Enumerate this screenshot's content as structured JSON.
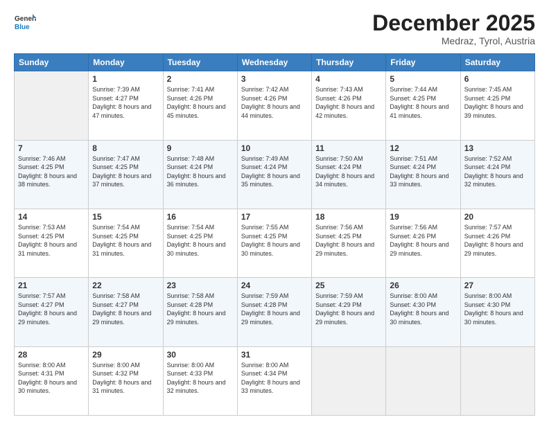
{
  "logo": {
    "line1": "General",
    "line2": "Blue"
  },
  "title": "December 2025",
  "location": "Medraz, Tyrol, Austria",
  "weekdays": [
    "Sunday",
    "Monday",
    "Tuesday",
    "Wednesday",
    "Thursday",
    "Friday",
    "Saturday"
  ],
  "weeks": [
    [
      {
        "day": null
      },
      {
        "day": "1",
        "sunrise": "7:39 AM",
        "sunset": "4:27 PM",
        "daylight": "8 hours and 47 minutes."
      },
      {
        "day": "2",
        "sunrise": "7:41 AM",
        "sunset": "4:26 PM",
        "daylight": "8 hours and 45 minutes."
      },
      {
        "day": "3",
        "sunrise": "7:42 AM",
        "sunset": "4:26 PM",
        "daylight": "8 hours and 44 minutes."
      },
      {
        "day": "4",
        "sunrise": "7:43 AM",
        "sunset": "4:26 PM",
        "daylight": "8 hours and 42 minutes."
      },
      {
        "day": "5",
        "sunrise": "7:44 AM",
        "sunset": "4:25 PM",
        "daylight": "8 hours and 41 minutes."
      },
      {
        "day": "6",
        "sunrise": "7:45 AM",
        "sunset": "4:25 PM",
        "daylight": "8 hours and 39 minutes."
      }
    ],
    [
      {
        "day": "7",
        "sunrise": "7:46 AM",
        "sunset": "4:25 PM",
        "daylight": "8 hours and 38 minutes."
      },
      {
        "day": "8",
        "sunrise": "7:47 AM",
        "sunset": "4:25 PM",
        "daylight": "8 hours and 37 minutes."
      },
      {
        "day": "9",
        "sunrise": "7:48 AM",
        "sunset": "4:24 PM",
        "daylight": "8 hours and 36 minutes."
      },
      {
        "day": "10",
        "sunrise": "7:49 AM",
        "sunset": "4:24 PM",
        "daylight": "8 hours and 35 minutes."
      },
      {
        "day": "11",
        "sunrise": "7:50 AM",
        "sunset": "4:24 PM",
        "daylight": "8 hours and 34 minutes."
      },
      {
        "day": "12",
        "sunrise": "7:51 AM",
        "sunset": "4:24 PM",
        "daylight": "8 hours and 33 minutes."
      },
      {
        "day": "13",
        "sunrise": "7:52 AM",
        "sunset": "4:24 PM",
        "daylight": "8 hours and 32 minutes."
      }
    ],
    [
      {
        "day": "14",
        "sunrise": "7:53 AM",
        "sunset": "4:25 PM",
        "daylight": "8 hours and 31 minutes."
      },
      {
        "day": "15",
        "sunrise": "7:54 AM",
        "sunset": "4:25 PM",
        "daylight": "8 hours and 31 minutes."
      },
      {
        "day": "16",
        "sunrise": "7:54 AM",
        "sunset": "4:25 PM",
        "daylight": "8 hours and 30 minutes."
      },
      {
        "day": "17",
        "sunrise": "7:55 AM",
        "sunset": "4:25 PM",
        "daylight": "8 hours and 30 minutes."
      },
      {
        "day": "18",
        "sunrise": "7:56 AM",
        "sunset": "4:25 PM",
        "daylight": "8 hours and 29 minutes."
      },
      {
        "day": "19",
        "sunrise": "7:56 AM",
        "sunset": "4:26 PM",
        "daylight": "8 hours and 29 minutes."
      },
      {
        "day": "20",
        "sunrise": "7:57 AM",
        "sunset": "4:26 PM",
        "daylight": "8 hours and 29 minutes."
      }
    ],
    [
      {
        "day": "21",
        "sunrise": "7:57 AM",
        "sunset": "4:27 PM",
        "daylight": "8 hours and 29 minutes."
      },
      {
        "day": "22",
        "sunrise": "7:58 AM",
        "sunset": "4:27 PM",
        "daylight": "8 hours and 29 minutes."
      },
      {
        "day": "23",
        "sunrise": "7:58 AM",
        "sunset": "4:28 PM",
        "daylight": "8 hours and 29 minutes."
      },
      {
        "day": "24",
        "sunrise": "7:59 AM",
        "sunset": "4:28 PM",
        "daylight": "8 hours and 29 minutes."
      },
      {
        "day": "25",
        "sunrise": "7:59 AM",
        "sunset": "4:29 PM",
        "daylight": "8 hours and 29 minutes."
      },
      {
        "day": "26",
        "sunrise": "8:00 AM",
        "sunset": "4:30 PM",
        "daylight": "8 hours and 30 minutes."
      },
      {
        "day": "27",
        "sunrise": "8:00 AM",
        "sunset": "4:30 PM",
        "daylight": "8 hours and 30 minutes."
      }
    ],
    [
      {
        "day": "28",
        "sunrise": "8:00 AM",
        "sunset": "4:31 PM",
        "daylight": "8 hours and 30 minutes."
      },
      {
        "day": "29",
        "sunrise": "8:00 AM",
        "sunset": "4:32 PM",
        "daylight": "8 hours and 31 minutes."
      },
      {
        "day": "30",
        "sunrise": "8:00 AM",
        "sunset": "4:33 PM",
        "daylight": "8 hours and 32 minutes."
      },
      {
        "day": "31",
        "sunrise": "8:00 AM",
        "sunset": "4:34 PM",
        "daylight": "8 hours and 33 minutes."
      },
      {
        "day": null
      },
      {
        "day": null
      },
      {
        "day": null
      }
    ]
  ]
}
